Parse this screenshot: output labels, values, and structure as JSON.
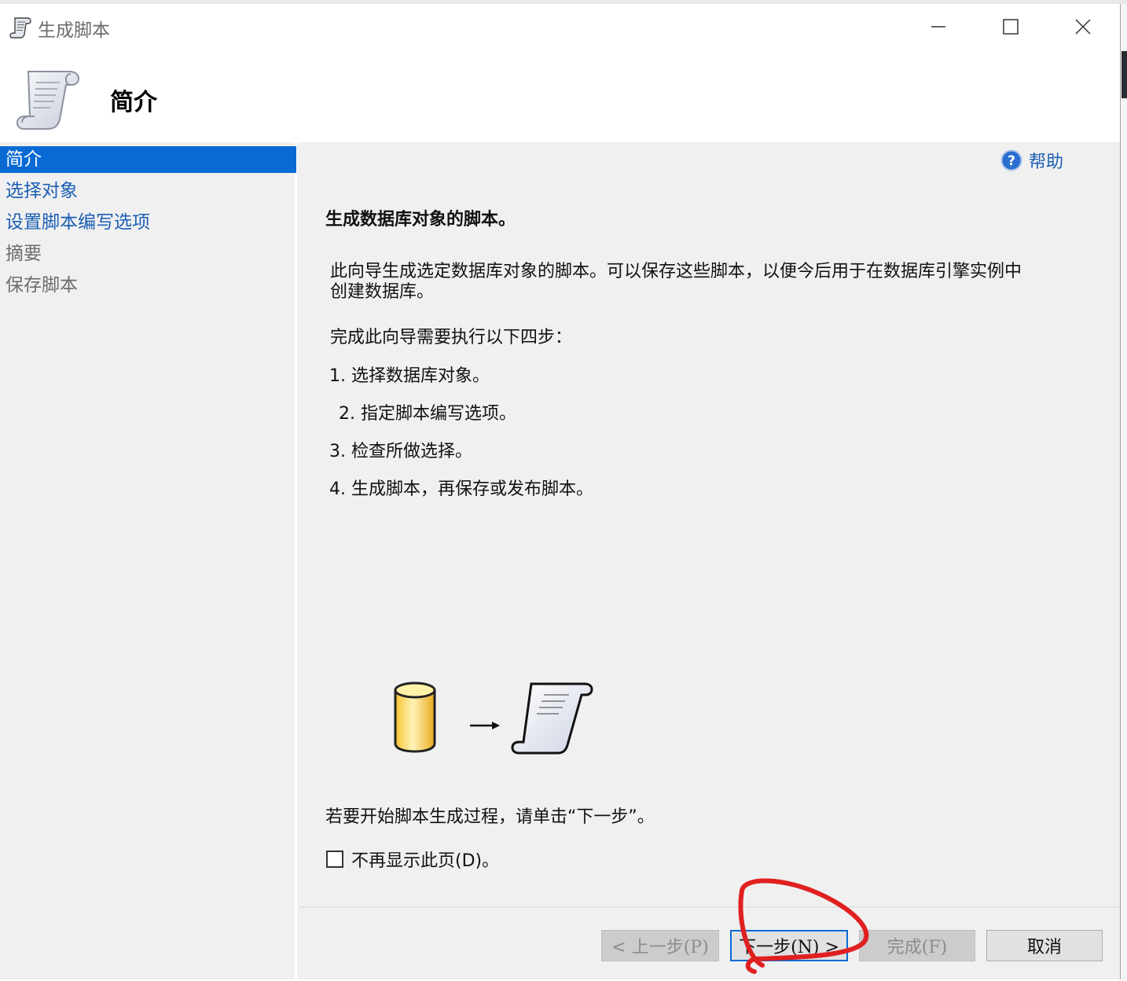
{
  "window": {
    "title": "生成脚本"
  },
  "header": {
    "title": "简介"
  },
  "sidebar": {
    "items": [
      {
        "label": "简介",
        "state": "active"
      },
      {
        "label": "选择对象",
        "state": "link"
      },
      {
        "label": "设置脚本编写选项",
        "state": "link"
      },
      {
        "label": "摘要",
        "state": "disabled"
      },
      {
        "label": "保存脚本",
        "state": "disabled"
      }
    ]
  },
  "content": {
    "help_label": "帮助",
    "heading": "生成数据库对象的脚本。",
    "description_line1": "此向导生成选定数据库对象的脚本。可以保存这些脚本，以便今后用于在数据库引擎实例中",
    "description_line2": "创建数据库。",
    "steps_intro": "完成此向导需要执行以下四步：",
    "steps": [
      "1. 选择数据库对象。",
      "2. 指定脚本编写选项。",
      "3. 检查所做选择。",
      "4. 生成脚本，再保存或发布脚本。"
    ],
    "instruction": "若要开始脚本生成过程，请单击“下一步”。",
    "checkbox_label": "不再显示此页(D)。",
    "checkbox_checked": false
  },
  "buttons": {
    "previous": "< 上一步(P)",
    "next": "下一步(N) >",
    "finish": "完成(F)",
    "cancel": "取消"
  },
  "colors": {
    "accent": "#0a6ad4",
    "link": "#1b5fb4",
    "annotation": "#e02020"
  },
  "icons": {
    "title": "script-scroll-icon",
    "header": "script-scroll-icon",
    "help": "help-icon",
    "illustration": [
      "database-icon",
      "arrow-right-icon",
      "script-scroll-icon"
    ]
  }
}
